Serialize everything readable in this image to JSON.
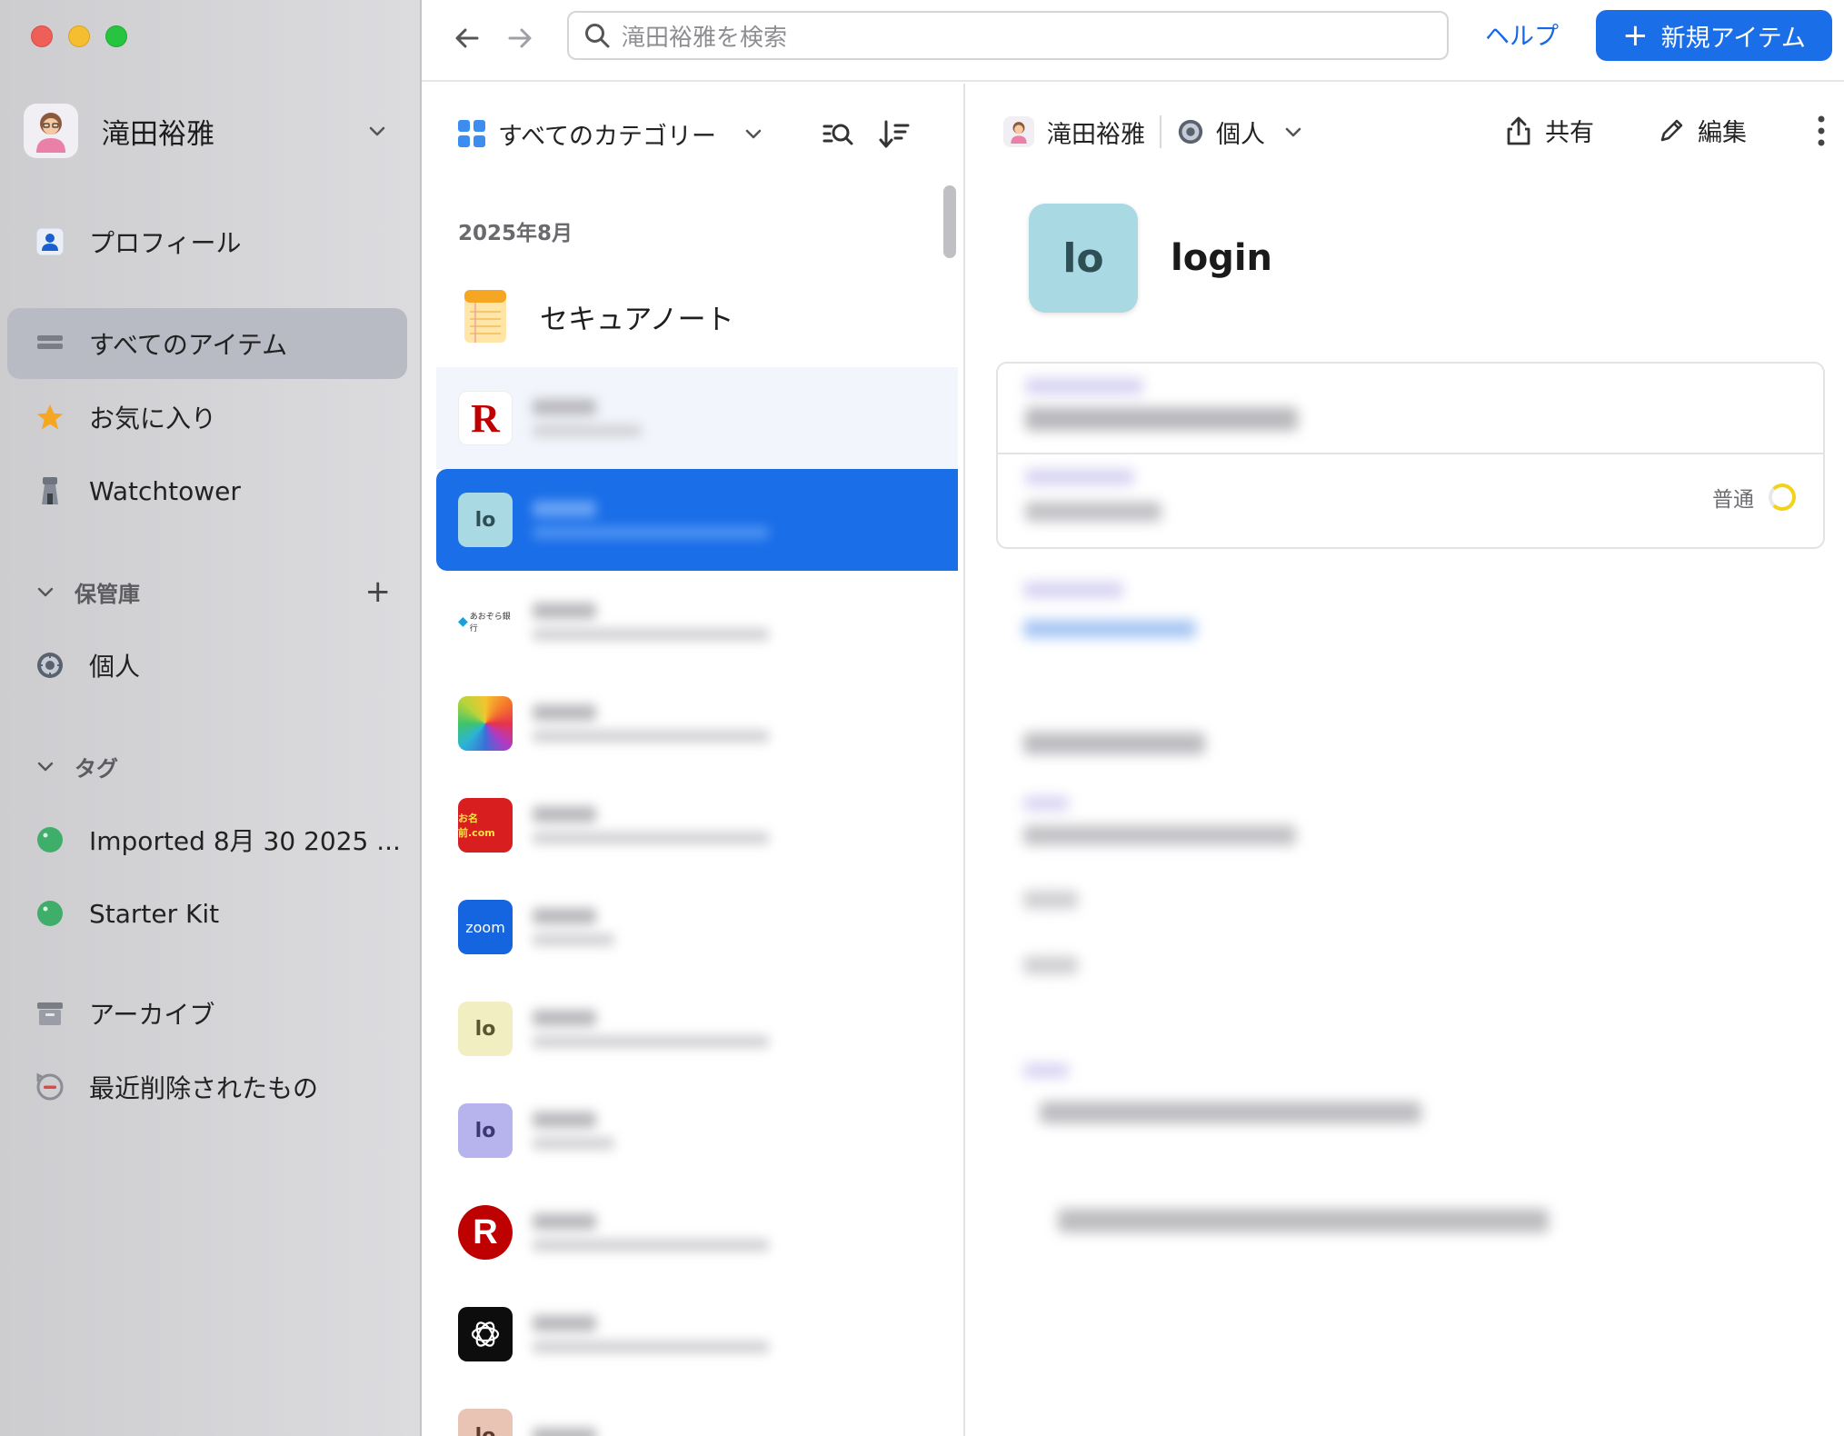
{
  "window": {
    "controls": [
      "close",
      "minimize",
      "zoom"
    ]
  },
  "account": {
    "name": "滝田裕雅"
  },
  "sidebar": {
    "items": [
      {
        "label": "プロフィール",
        "icon": "profile-icon"
      },
      {
        "label": "すべてのアイテム",
        "icon": "all-items-icon",
        "selected": true
      },
      {
        "label": "お気に入り",
        "icon": "star-icon"
      },
      {
        "label": "Watchtower",
        "icon": "watchtower-icon"
      }
    ],
    "vaults_header": "保管庫",
    "vaults": [
      {
        "label": "個人",
        "icon": "vault-icon"
      }
    ],
    "tags_header": "タグ",
    "tags": [
      {
        "label": "Imported 8月 30 2025 ...",
        "color": "#3fae6a"
      },
      {
        "label": "Starter Kit",
        "color": "#3fae6a"
      }
    ],
    "bottom": [
      {
        "label": "アーカイブ",
        "icon": "archive-icon"
      },
      {
        "label": "最近削除されたもの",
        "icon": "recently-deleted-icon"
      }
    ]
  },
  "topbar": {
    "search_placeholder": "滝田裕雅を検索",
    "help_label": "ヘルプ",
    "new_item_label": "新規アイテム"
  },
  "list": {
    "category_label": "すべてのカテゴリー",
    "month_label": "2025年8月",
    "first_item_title": "セキュアノート",
    "icons": {
      "rakuten_letter": "R",
      "lo": "lo",
      "zoom": "zoom",
      "onamae": "お名前.com",
      "aozora": "あおぞら銀行"
    }
  },
  "detail": {
    "owner": "滝田裕雅",
    "vault": "個人",
    "share_label": "共有",
    "edit_label": "編集",
    "item_icon_text": "lo",
    "item_title": "login",
    "strength_label": "普通"
  },
  "colors": {
    "accent": "#1a6ee8",
    "selected_sidebar": "#b9bbc4",
    "tag_green": "#3fae6a",
    "strength_yellow": "#f2d21a"
  }
}
